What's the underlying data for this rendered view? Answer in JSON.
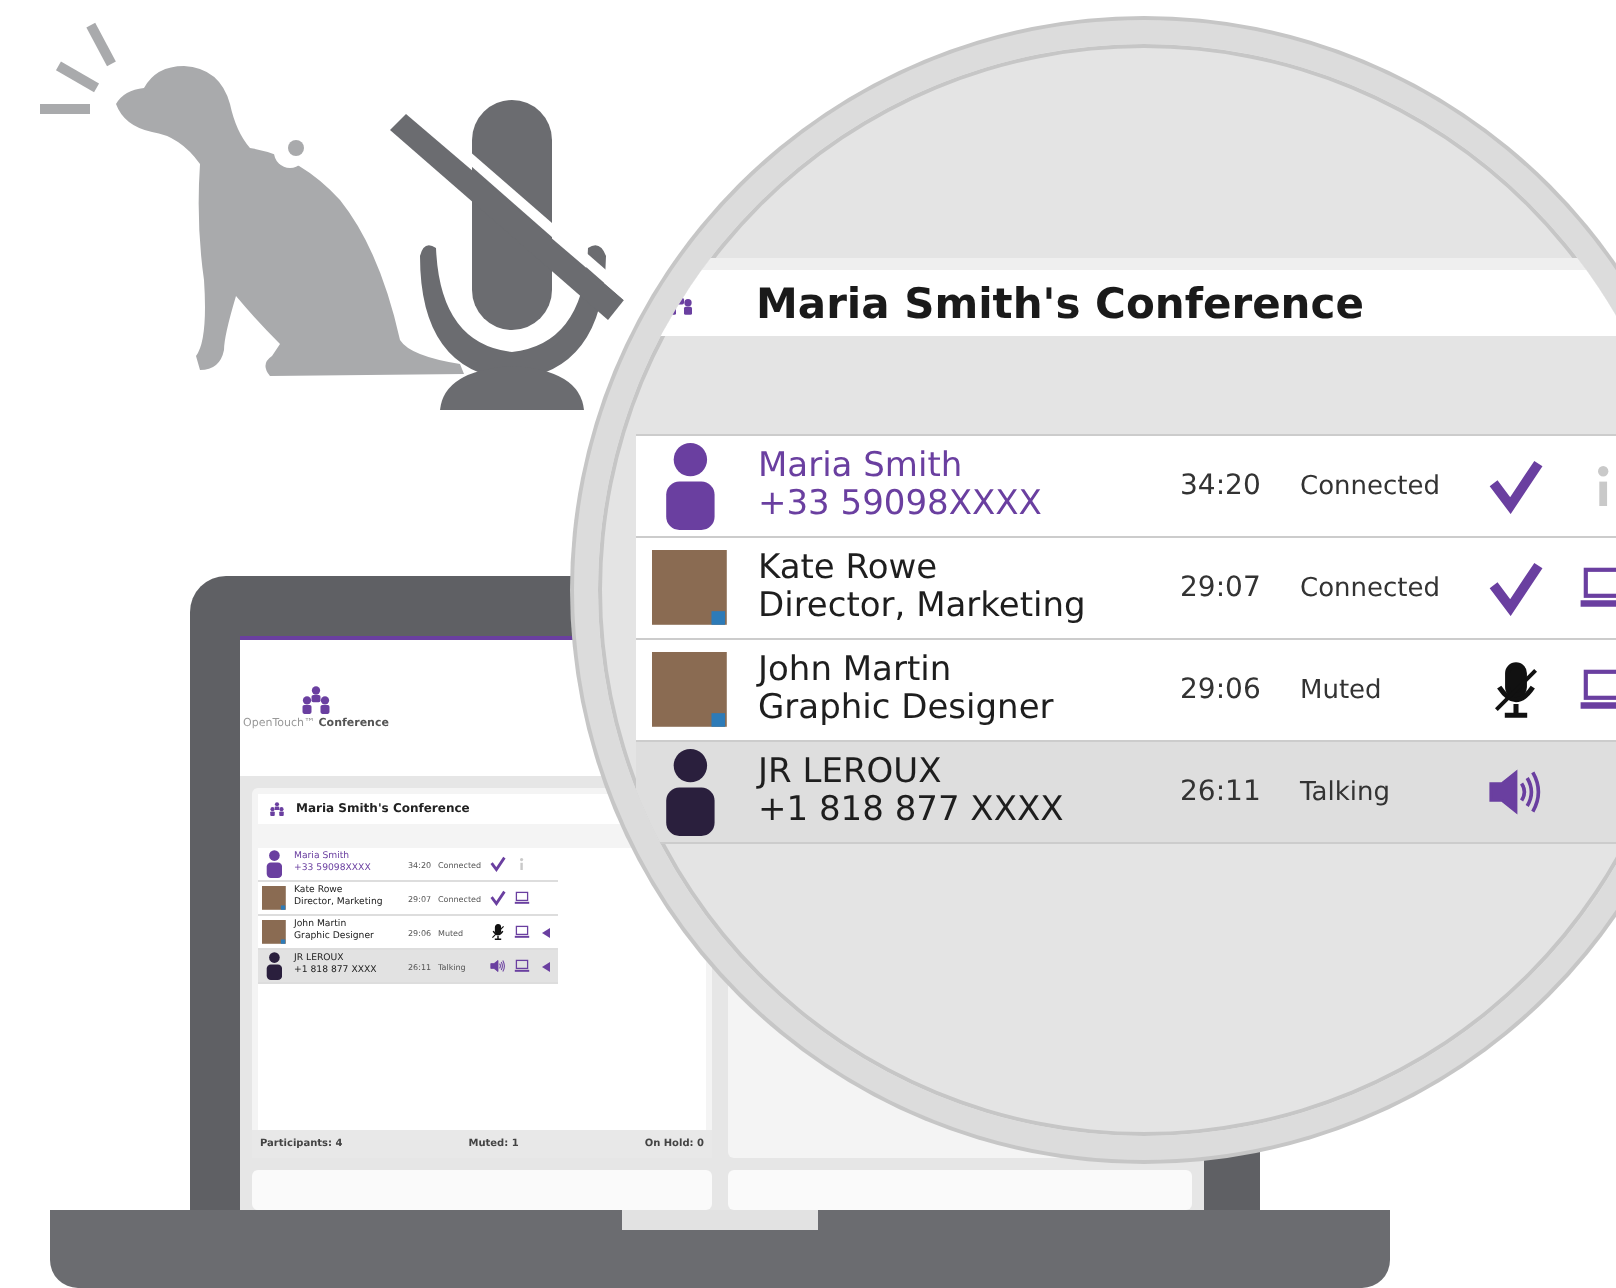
{
  "screen": {
    "logo": {
      "product_name": "OpenTouch™ **Conference**"
    },
    "conference_panel": {
      "title": "Maria Smith's Conference",
      "participants": [
        {
          "name": "Maria Smith",
          "detail": "+33 59098XXXX",
          "time": "34:20",
          "status": "Connected",
          "avatar": {
            "kind": "person"
          },
          "host": true,
          "highlighted": false,
          "status_icon": {
            "kind": "check"
          },
          "device": {
            "kind": "info"
          },
          "arrow": false
        },
        {
          "name": "Kate Rowe",
          "detail": "Director, Marketing",
          "time": "29:07",
          "status": "Connected",
          "avatar": {
            "kind": "photo"
          },
          "host": false,
          "highlighted": false,
          "status_icon": {
            "kind": "check"
          },
          "device": {
            "kind": "laptop"
          },
          "arrow": false
        },
        {
          "name": "John Martin",
          "detail": "Graphic Designer",
          "time": "29:06",
          "status": "Muted",
          "avatar": {
            "kind": "photo"
          },
          "host": false,
          "highlighted": false,
          "status_icon": {
            "kind": "mic-off"
          },
          "device": {
            "kind": "laptop"
          },
          "arrow": true
        },
        {
          "name": "JR LEROUX",
          "detail": "+1 818 877 XXXX",
          "time": "26:11",
          "status": "Talking",
          "avatar": {
            "kind": "person"
          },
          "host": false,
          "highlighted": true,
          "status_icon": {
            "kind": "speaker"
          },
          "device": {
            "kind": "laptop"
          },
          "arrow": true
        }
      ],
      "footer": [
        "Participants: 4",
        "Muted: 1",
        "On Hold: 0"
      ]
    }
  },
  "magnifier": {
    "title": "Maria Smith's Conference",
    "participants": [
      {
        "name": "Maria Smith",
        "detail": "+33 59098XXXX",
        "time": "34:20",
        "status": "Connected",
        "avatar": {
          "kind": "person"
        },
        "host": true,
        "highlighted": false,
        "status_icon": {
          "kind": "check"
        },
        "device": {
          "kind": "info"
        }
      },
      {
        "name": "Kate Rowe",
        "detail": "Director, Marketing",
        "time": "29:07",
        "status": "Connected",
        "avatar": {
          "kind": "photo"
        },
        "host": false,
        "highlighted": false,
        "status_icon": {
          "kind": "check"
        },
        "device": {
          "kind": "laptop"
        }
      },
      {
        "name": "John Martin",
        "detail": "Graphic Designer",
        "time": "29:06",
        "status": "Muted",
        "avatar": {
          "kind": "photo"
        },
        "host": false,
        "highlighted": false,
        "status_icon": {
          "kind": "mic-off"
        },
        "device": {
          "kind": "laptop"
        }
      },
      {
        "name": "JR LEROUX",
        "detail": "+1 818 877 XXXX",
        "time": "26:11",
        "status": "Talking",
        "avatar": {
          "kind": "person"
        },
        "host": false,
        "highlighted": true,
        "status_icon": {
          "kind": "speaker"
        }
      }
    ]
  }
}
